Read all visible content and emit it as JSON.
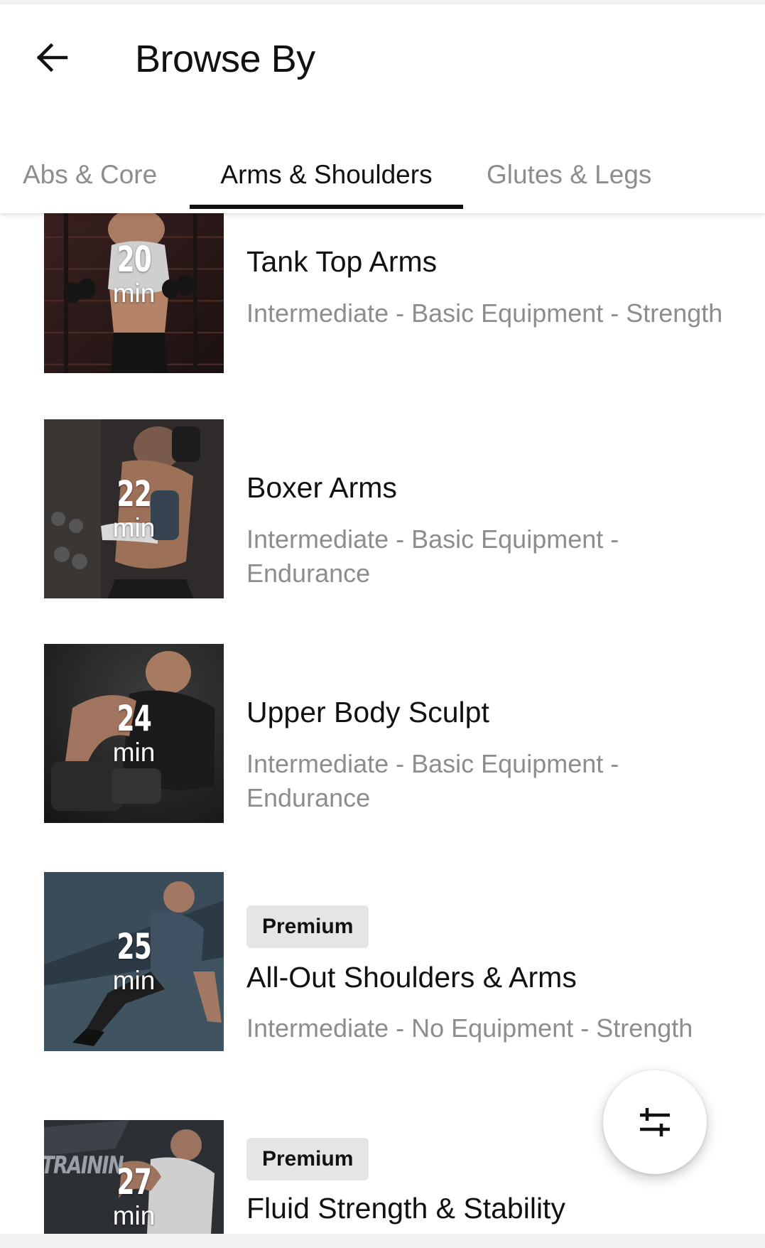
{
  "header": {
    "back_icon": "arrow-left-icon",
    "title": "Browse By"
  },
  "tabs": [
    {
      "label": "Abs & Core",
      "active": false
    },
    {
      "label": "Arms & Shoulders",
      "active": true
    },
    {
      "label": "Glutes & Legs",
      "active": false
    }
  ],
  "workouts": [
    {
      "duration": "20",
      "unit": "min",
      "title": "Tank Top Arms",
      "meta": "Intermediate - Basic Equipment - Strength",
      "badge": ""
    },
    {
      "duration": "22",
      "unit": "min",
      "title": "Boxer Arms",
      "meta": "Intermediate - Basic Equipment - Endurance",
      "badge": ""
    },
    {
      "duration": "24",
      "unit": "min",
      "title": "Upper Body Sculpt",
      "meta": "Intermediate - Basic Equipment - Endurance",
      "badge": ""
    },
    {
      "duration": "25",
      "unit": "min",
      "title": "All-Out Shoulders & Arms",
      "meta": "Intermediate - No Equipment - Strength",
      "badge": "Premium"
    },
    {
      "duration": "27",
      "unit": "min",
      "title": "Fluid Strength & Stability",
      "meta": "",
      "badge": "Premium"
    }
  ],
  "thumbnail_texts": {
    "banner_text": "TRAININ"
  },
  "filter_button": {
    "icon": "sliders-filter-icon"
  },
  "colors": {
    "primary_text": "#111111",
    "secondary_text": "#8d8d8d",
    "badge_bg": "#e5e5e5",
    "indicator": "#111111"
  }
}
